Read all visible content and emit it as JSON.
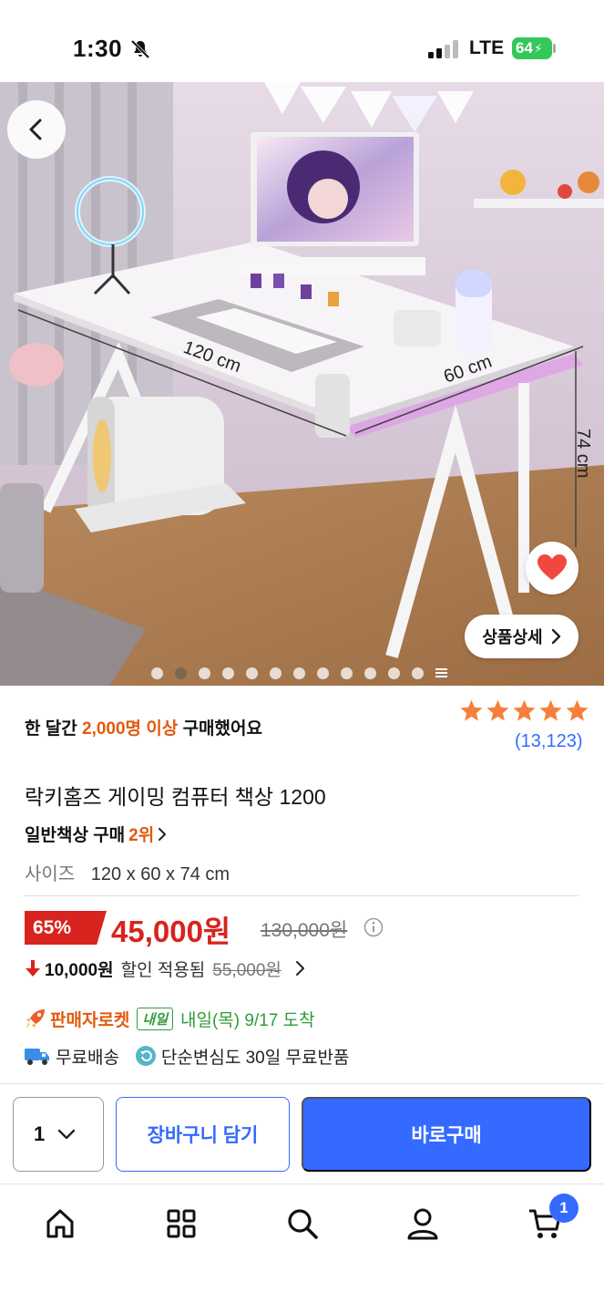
{
  "status_bar": {
    "time": "1:30",
    "network": "LTE",
    "battery": "64"
  },
  "hero": {
    "dimension_width": "120 cm",
    "dimension_depth": "60 cm",
    "dimension_height": "74 cm",
    "detail_button_label": "상품상세",
    "image_count_dots": 12,
    "active_dot_index": 1
  },
  "product": {
    "purchase_prefix": "한 달간",
    "purchase_highlight": "2,000명 이상",
    "purchase_suffix": "구매했어요",
    "rating_stars": 5,
    "review_count": "(13,123)",
    "title": "락키홈즈 게이밍 컴퓨터 책상 1200",
    "category": "일반책상 구매",
    "category_rank": "2위",
    "size_label": "사이즈",
    "size_value": "120 x 60 x 74 cm"
  },
  "price": {
    "discount_rate": "65%",
    "sale_price": "45,000원",
    "original_price": "130,000원",
    "coupon_amount": "10,000원",
    "coupon_text": "할인 적용됨",
    "coupon_old_price": "55,000원"
  },
  "delivery": {
    "rocket_label": "판매자로켓",
    "tomorrow_badge": "내일",
    "arrival": "내일(목) 9/17 도착",
    "free_shipping": "무료배송",
    "free_return": "단순변심도 30일 무료반품"
  },
  "actions": {
    "quantity": "1",
    "add_to_cart": "장바구니 담기",
    "buy_now": "바로구매"
  },
  "tab_bar": {
    "cart_count": "1"
  },
  "colors": {
    "accent_blue": "#346aff",
    "sale_red": "#d9231e",
    "highlight_orange": "#e25a0e",
    "delivery_green": "#2e9e37",
    "star_orange": "#f5803e"
  }
}
